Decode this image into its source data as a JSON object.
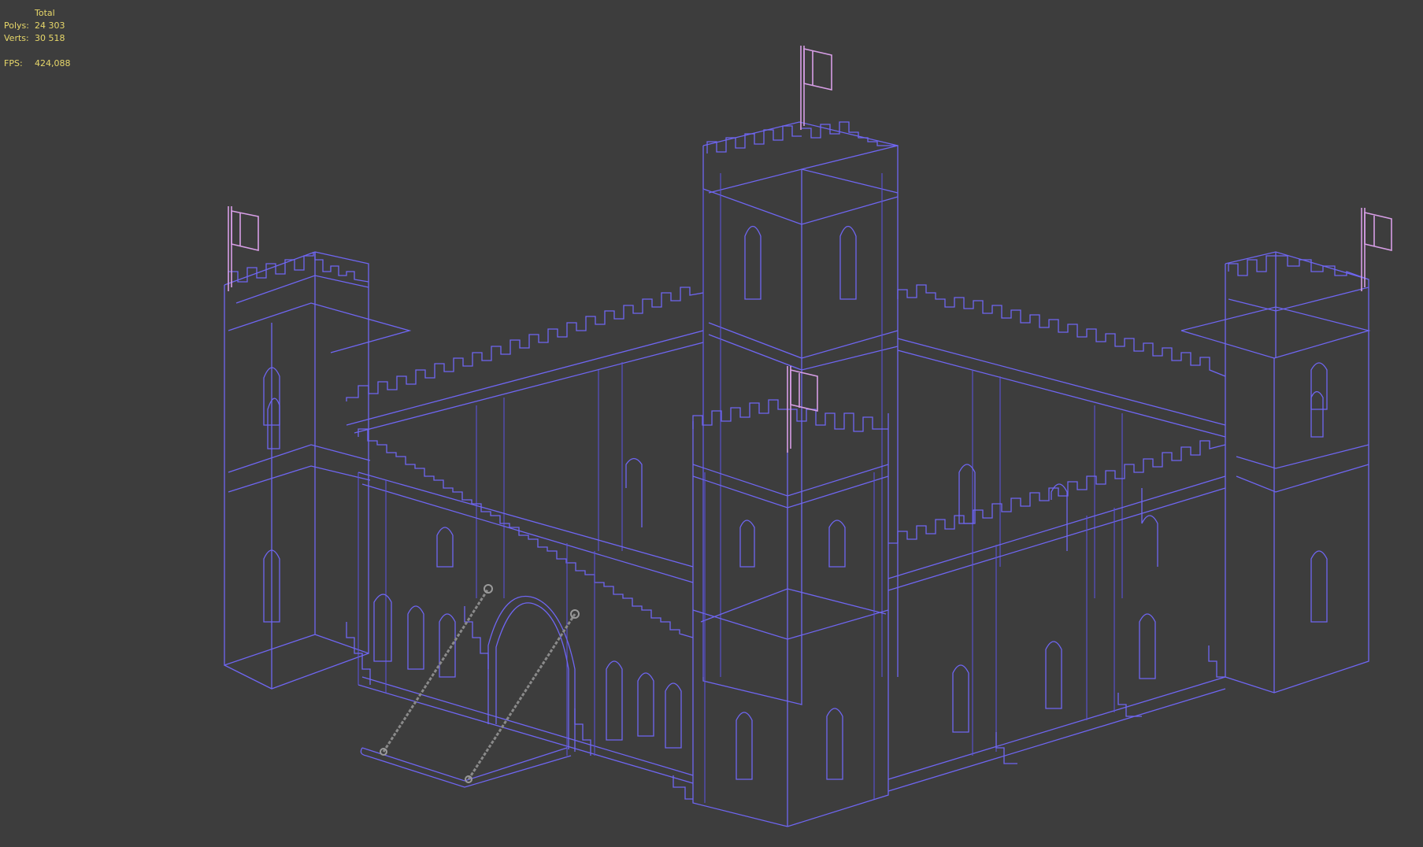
{
  "stats": {
    "header": "Total",
    "polys_label": "Polys:",
    "polys_value": "24 303",
    "verts_label": "Verts:",
    "verts_value": "30 518",
    "fps_label": "FPS:",
    "fps_value": "424,088"
  },
  "colors": {
    "background": "#3d3d3d",
    "stats_text": "#e8d86a",
    "wireframe": "#6f66f2",
    "flags": "#d79ee6",
    "chains": "#8a8a8a"
  },
  "icons": {
    "model": "castle-wireframe",
    "flag": "flag-icon",
    "chain": "chain-icon"
  }
}
